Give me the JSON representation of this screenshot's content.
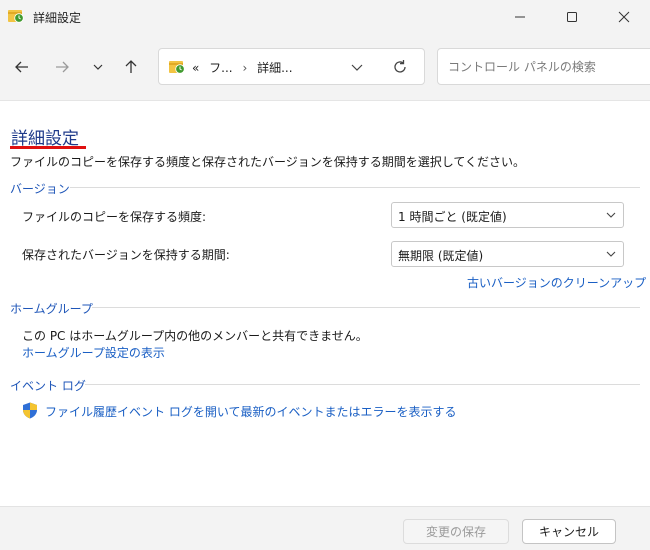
{
  "window": {
    "title": "詳細設定",
    "app_icon": "file-history-icon"
  },
  "titlebar": {
    "minimize_icon": "minimize-icon",
    "maximize_icon": "maximize-icon",
    "close_icon": "close-icon"
  },
  "nav": {
    "back_icon": "back-arrow-icon",
    "forward_icon": "forward-arrow-icon",
    "recent_icon": "chevron-down-icon",
    "up_icon": "up-arrow-icon",
    "breadcrumb": {
      "prefix": "«",
      "item1": "フ...",
      "separator": "›",
      "item2": "詳細..."
    },
    "refresh_icon": "refresh-icon",
    "search_placeholder": "コントロール パネルの検索"
  },
  "main": {
    "title": "詳細設定",
    "description": "ファイルのコピーを保存する頻度と保存されたバージョンを保持する期間を選択してください。",
    "accent_color": "#e01010",
    "versions": {
      "header": "バージョン",
      "frequency_label": "ファイルのコピーを保存する頻度:",
      "frequency_value": "1 時間ごと (既定値)",
      "retention_label": "保存されたバージョンを保持する期間:",
      "retention_value": "無期限 (既定値)",
      "cleanup_link": "古いバージョンのクリーンアップ"
    },
    "homegroup": {
      "header": "ホームグループ",
      "message": "この PC はホームグループ内の他のメンバーと共有できません。",
      "settings_link": "ホームグループ設定の表示"
    },
    "eventlog": {
      "header": "イベント ログ",
      "link": "ファイル履歴イベント ログを開いて最新のイベントまたはエラーを表示する"
    }
  },
  "footer": {
    "save_label": "変更の保存",
    "cancel_label": "キャンセル"
  }
}
